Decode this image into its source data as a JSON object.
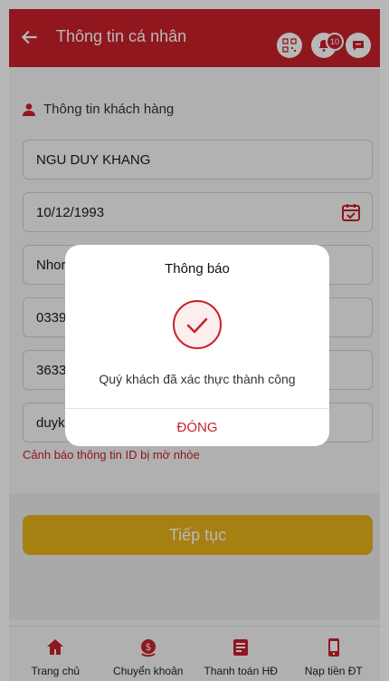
{
  "header": {
    "title": "Thông tin cá nhân",
    "notification_count": "10"
  },
  "section": {
    "title": "Thông tin khách hàng"
  },
  "fields": {
    "name": "NGU DUY KHANG",
    "dob": "10/12/1993",
    "field3": "Nhor",
    "field4": "0339",
    "field5": "3633",
    "field6": "duyk"
  },
  "warning": "Cảnh báo thông tin ID bị mờ nhòe",
  "continue_label": "Tiếp tục",
  "nav": {
    "items": [
      {
        "label": "Trang chủ"
      },
      {
        "label": "Chuyển khoản"
      },
      {
        "label": "Thanh toán HĐ"
      },
      {
        "label": "Nạp tiền ĐT"
      }
    ]
  },
  "modal": {
    "title": "Thông báo",
    "message": "Quý khách đã xác thực thành công",
    "close_label": "ĐÓNG"
  },
  "colors": {
    "primary": "#c8202a",
    "button": "#e7b21b"
  }
}
